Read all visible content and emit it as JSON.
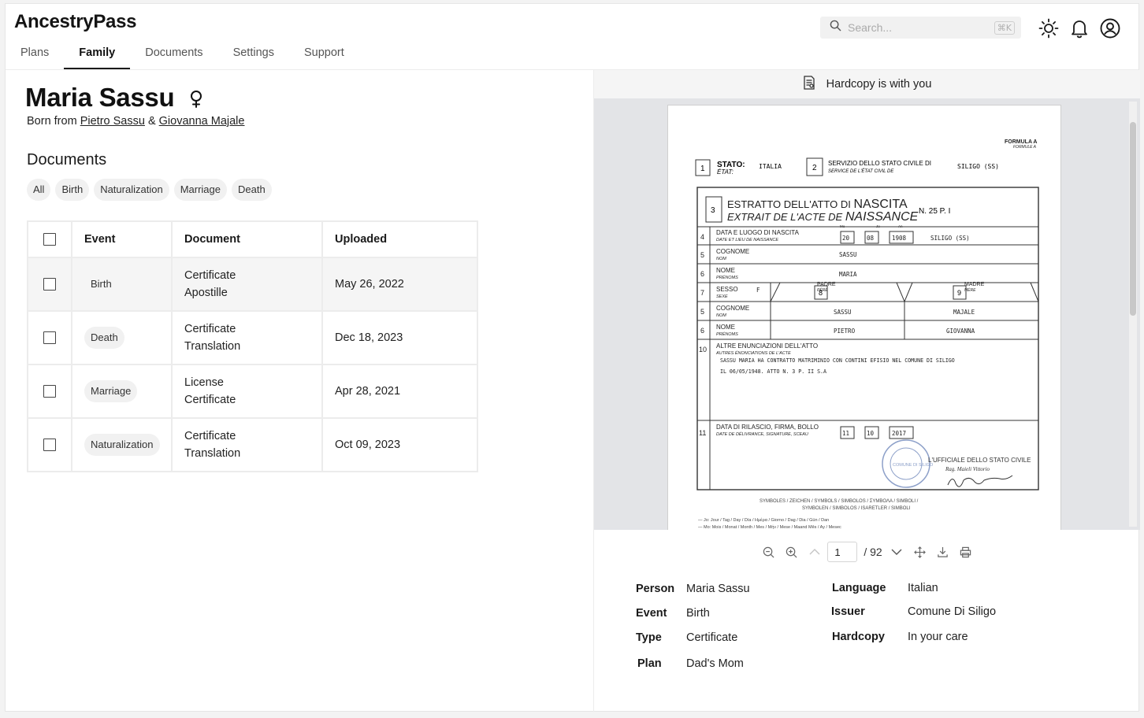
{
  "app": {
    "title": "AncestryPass"
  },
  "nav": {
    "items": [
      "Plans",
      "Family",
      "Documents",
      "Settings",
      "Support"
    ],
    "active": "Family"
  },
  "search": {
    "placeholder": "Search...",
    "shortcut": "⌘K"
  },
  "header_icons": [
    "sun-icon",
    "bell-icon",
    "user-circle-icon"
  ],
  "person": {
    "name": "Maria Sassu",
    "gender_icon": "female-icon",
    "born_prefix": "Born from",
    "father": "Pietro Sassu",
    "separator": "&",
    "mother": "Giovanna Majale"
  },
  "documents": {
    "heading": "Documents",
    "filters": [
      "All",
      "Birth",
      "Naturalization",
      "Marriage",
      "Death"
    ],
    "columns": [
      "Event",
      "Document",
      "Uploaded"
    ],
    "rows": [
      {
        "event": "Birth",
        "doc_line1": "Certificate",
        "doc_line2": "Apostille",
        "uploaded": "May 26, 2022",
        "selected": true
      },
      {
        "event": "Death",
        "doc_line1": "Certificate",
        "doc_line2": "Translation",
        "uploaded": "Dec 18, 2023",
        "selected": false
      },
      {
        "event": "Marriage",
        "doc_line1": "License",
        "doc_line2": "Certificate",
        "uploaded": "Apr 28, 2021",
        "selected": false
      },
      {
        "event": "Naturalization",
        "doc_line1": "Certificate",
        "doc_line2": "Translation",
        "uploaded": "Oct 09, 2023",
        "selected": false
      }
    ]
  },
  "viewer": {
    "banner": "Hardcopy is with you",
    "page_current": "1",
    "page_total": "/ 92",
    "tools": [
      "zoom-out-icon",
      "zoom-in-icon",
      "chevron-up-icon",
      "chevron-down-icon",
      "move-icon",
      "download-icon",
      "print-icon"
    ]
  },
  "certificate": {
    "formula": "FORMULA A",
    "formula_sub": "FORMULE A",
    "stato_label": "STATO:",
    "stato_sub": "ÉTAT:",
    "stato_value": "ITALIA",
    "servizio": "SERVIZIO DELLO STATO CIVILE DI",
    "servizio_sub": "SERVICE DE L'ÉTAT CIVIL DE",
    "servizio_value": "SILIGO (SS)",
    "estratto_a": "ESTRATTO DELL'ATTO DI",
    "estratto_b": "NASCITA",
    "extrait_a": "EXTRAIT DE L'ACTE DE",
    "extrait_b": "NAISSANCE",
    "atto_num": "N. 25  P. I",
    "data_label": "DATA E LUOGO DI NASCITA",
    "data_sub": "DATE ET LIEU DE NAISSANCE",
    "date_parts": [
      "20",
      "08",
      "1908"
    ],
    "date_heads": [
      "Jo",
      "Mo",
      "An"
    ],
    "place": "SILIGO (SS)",
    "cognome": "COGNOME",
    "cognome_sub": "NOM",
    "surname": "SASSU",
    "nome": "NOME",
    "nome_sub": "PRÉNOMS",
    "given": "MARIA",
    "sesso": "SESSO",
    "sesso_sub": "SEXE",
    "sex": "F",
    "padre": "PADRE",
    "padre_sub": "PÈRE",
    "madre": "MADRE",
    "madre_sub": "MÈRE",
    "father_surname": "SASSU",
    "mother_surname": "MAJALE",
    "father_name": "PIETRO",
    "mother_name": "GIOVANNA",
    "altre": "ALTRE ENUNCIAZIONI DELL'ATTO",
    "altre_sub": "AUTRES ÉNONCIATIONS DE L'ACTE",
    "note1": "SASSU MARIA HA CONTRATTO MATRIMINIO CON CONTINI EFISIO NEL COMUNE DI SILIGO",
    "note2": "IL 06/05/1948. ATTO N. 3 P. II S.A",
    "rilascio": "DATA DI RILASCIO, FIRMA, BOLLO",
    "rilascio_sub": "DATE DE DÉLIVRANCE, SIGNATURE, SCEAU",
    "issue_parts": [
      "11",
      "10",
      "2017"
    ],
    "ufficiale": "L'UFFICIALE DELLO STATO CIVILE",
    "ufficiale_name": "Rag. Maieli Vittorio",
    "stamp": "COMUNE DI SILIGO",
    "symbols1": "SYMBOLES  /  ZEICHEN  /  SYMBOLS  /  SIMBOLOS  /  ΣΥΜΒΟΛΑ  /  SIMBOLI  /",
    "symbols2": "SYMBOLEN  /  SIMBOLOS  /  ISARETLER  /  SIMBOLI",
    "legend1": "— Jo: Jour / Tag / Day / Día / Ημέρα / Giorno / Dag / Dia / Gün / Dan",
    "legend2": "— Mo: Mois / Monat / Month / Mes / Μήν / Mese / Maand  Mês / Ay / Mesec",
    "field_numbers": [
      "1",
      "2",
      "3",
      "4",
      "5",
      "6",
      "7",
      "8",
      "9",
      "5",
      "6",
      "10",
      "11"
    ]
  },
  "details": {
    "person_label": "Person",
    "person_value": "Maria Sassu",
    "event_label": "Event",
    "event_value": "Birth",
    "type_label": "Type",
    "type_value": "Certificate",
    "plan_label": "Plan",
    "plan_value": "Dad's Mom",
    "language_label": "Language",
    "language_value": "Italian",
    "issuer_label": "Issuer",
    "issuer_value": "Comune Di Siligo",
    "hardcopy_label": "Hardcopy",
    "hardcopy_value": "In your care"
  }
}
